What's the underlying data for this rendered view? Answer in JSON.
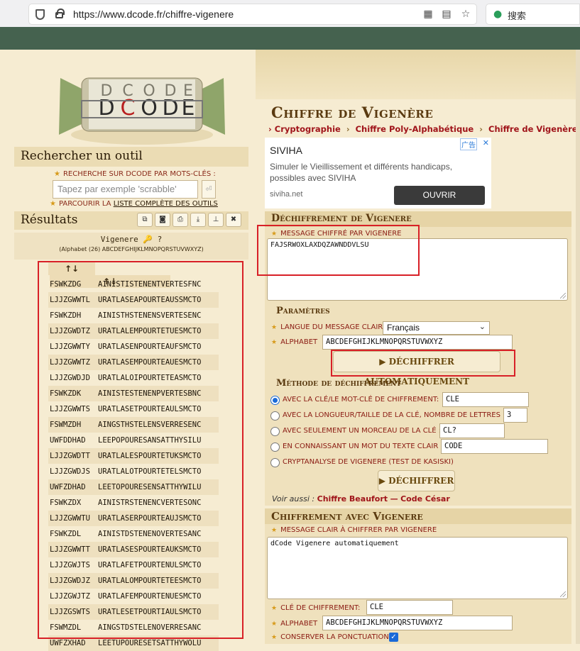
{
  "browser": {
    "url": "https://www.dcode.fr/chiffre-vigenere",
    "search_label": "搜索"
  },
  "left": {
    "search_title": "Rechercher un outil",
    "kw_hint": "RECHERCHE SUR DCODE PAR MOTS-CLÉS :",
    "search_placeholder": "Tapez par exemple 'scrabble'",
    "browse_prefix": "PARCOURIR LA",
    "browse_link": "LISTE COMPLÈTE DES OUTILS",
    "results_title": "Résultats",
    "res_head_title": "Vigenere 🔑 ?",
    "res_head_alpha": "(Alphabet (26) ABCDEFGHIJKLMNOPQRSTUVWXYZ)",
    "col1_header": "↑↓",
    "col2_header": "↑↓",
    "rows": [
      [
        "FSWKZDG",
        "AINISTISTENENTVERTESFNC"
      ],
      [
        "LJJZGWWTL",
        "URATLASEAPOURTEAUSSMCTO"
      ],
      [
        "FSWKZDH",
        "AINISTHSTENENSVERTESENC"
      ],
      [
        "LJJZGWDTZ",
        "URATLALEMPOURTETUESMCTO"
      ],
      [
        "LJJZGWWTY",
        "URATLASENPOURTEAUFSMCTO"
      ],
      [
        "LJJZGWWTZ",
        "URATLASEMPOURTEAUESMCTO"
      ],
      [
        "LJJZGWDJD",
        "URATLALOIPOURTETEASMCTO"
      ],
      [
        "FSWKZDK",
        "AINISTESTENENPVERTESBNC"
      ],
      [
        "LJJZGWWTS",
        "URATLASETPOURTEAULSMCTO"
      ],
      [
        "FSWMZDH",
        "AINGSTHSTELENSVERRESENC"
      ],
      [
        "UWFDDHAD",
        "LEEPOPOURESANSATTHYSILU"
      ],
      [
        "LJJZGWDTT",
        "URATLALESPOURTETUKSMCTO"
      ],
      [
        "LJJZGWDJS",
        "URATLALOTPOURTETELSMCTO"
      ],
      [
        "UWFZDHAD",
        "LEETOPOURESENSATTHYWILU"
      ],
      [
        "FSWKZDX",
        "AINISTRSTENENCVERTESONC"
      ],
      [
        "LJJZGWWTU",
        "URATLASERPOURTEAUJSMCTO"
      ],
      [
        "FSWKZDL",
        "AINISTDSTENENOVERTESANC"
      ],
      [
        "LJJZGWWTT",
        "URATLASESPOURTEAUKSMCTO"
      ],
      [
        "LJJZGWJTS",
        "URATLAFETPOURTENULSMCTO"
      ],
      [
        "LJJZGWDJZ",
        "URATLALOMPOURTETEESMCTO"
      ],
      [
        "LJJZGWJTZ",
        "URATLAFEMPOURTENUESMCTO"
      ],
      [
        "LJJZGSWTS",
        "URATLESETPOURTIAULSMCTO"
      ],
      [
        "FSWMZDL",
        "AINGSTDSTELENOVERRESANC"
      ],
      [
        "UWFZXHAD",
        "LEETUPOURESETSATTHYWOLU"
      ]
    ]
  },
  "right": {
    "title": "Chiffre de Vigenère",
    "crumbs": [
      "Cryptographie",
      "Chiffre Poly-Alphabétique",
      "Chiffre de Vigenère"
    ],
    "ad": {
      "brand": "SIVIHA",
      "desc": "Simuler le Vieillissement et différents handicaps, possibles avec SIVIHA",
      "domain": "siviha.net",
      "open": "OUVRIR",
      "tag": "广告",
      "close": "✕"
    },
    "decrypt": {
      "header": "Déchiffrement de Vigenere",
      "msg_label": "MESSAGE CHIFFRÉ PAR VIGENERE",
      "msg_value": "FAJSRWOXLAXDQZAWNDDVLSU",
      "params_title": "Paramètres",
      "lang_label": "LANGUE DU MESSAGE CLAIR",
      "lang_value": "Français",
      "alpha_label": "ALPHABET",
      "alpha_value": "ABCDEFGHIJKLMNOPQRSTUVWXYZ",
      "auto_button": "▶ DÉCHIFFRER AUTOMATIQUEMENT",
      "method_title": "Méthode de déchiffrement",
      "options": [
        {
          "label": "AVEC LA CLÉ/LE MOT-CLÉ DE CHIFFREMENT:",
          "value": "CLE",
          "checked": true
        },
        {
          "label": "AVEC LA LONGUEUR/TAILLE DE LA CLÉ, NOMBRE DE LETTRES :",
          "value": "3",
          "checked": false
        },
        {
          "label": "AVEC SEULEMENT UN MORCEAU DE LA CLÉ :",
          "value": "CL?",
          "checked": false
        },
        {
          "label": "EN CONNAISSANT UN MOT DU TEXTE CLAIR :",
          "value": "CODE",
          "checked": false
        },
        {
          "label": "CRYPTANALYSE DE VIGENERE (TEST DE KASISKI)",
          "value": "",
          "checked": false
        }
      ],
      "decrypt_button": "▶ DÉCHIFFRER",
      "see_also": "Voir aussi :",
      "see_link1": "Chiffre Beaufort",
      "see_sep": "—",
      "see_link2": "Code César"
    },
    "encrypt": {
      "header": "Chiffrement avec Vigenere",
      "msg_label": "MESSAGE CLAIR À CHIFFRER PAR VIGENERE",
      "msg_value": "dCode Vigenere automatiquement",
      "key_label": "CLÉ DE CHIFFREMENT:",
      "key_value": "CLE",
      "alpha_label": "ALPHABET",
      "alpha_value": "ABCDEFGHIJKLMNOPQRSTUVWXYZ",
      "punct_label": "CONSERVER LA PONCTUATION"
    }
  }
}
